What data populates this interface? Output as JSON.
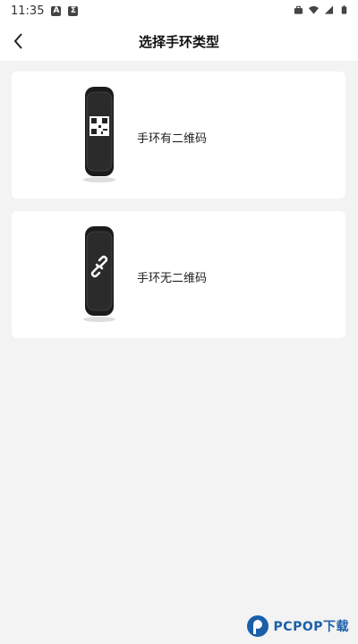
{
  "status_bar": {
    "time": "11:35",
    "notification_icons": [
      "a-icon",
      "sigma-icon"
    ],
    "system_icons": [
      "briefcase-icon",
      "wifi-icon",
      "signal-icon",
      "battery-icon"
    ]
  },
  "header": {
    "title": "选择手环类型",
    "back_icon": "back-arrow-icon"
  },
  "cards": [
    {
      "label": "手环有二维码",
      "icon": "qr-band-icon"
    },
    {
      "label": "手环无二维码",
      "icon": "link-band-icon"
    }
  ],
  "watermark": {
    "text": "PCPOP下载"
  },
  "colors": {
    "background": "#f3f3f3",
    "card": "#ffffff",
    "band": "#1b1b1b",
    "watermark": "#1a5fa8"
  }
}
